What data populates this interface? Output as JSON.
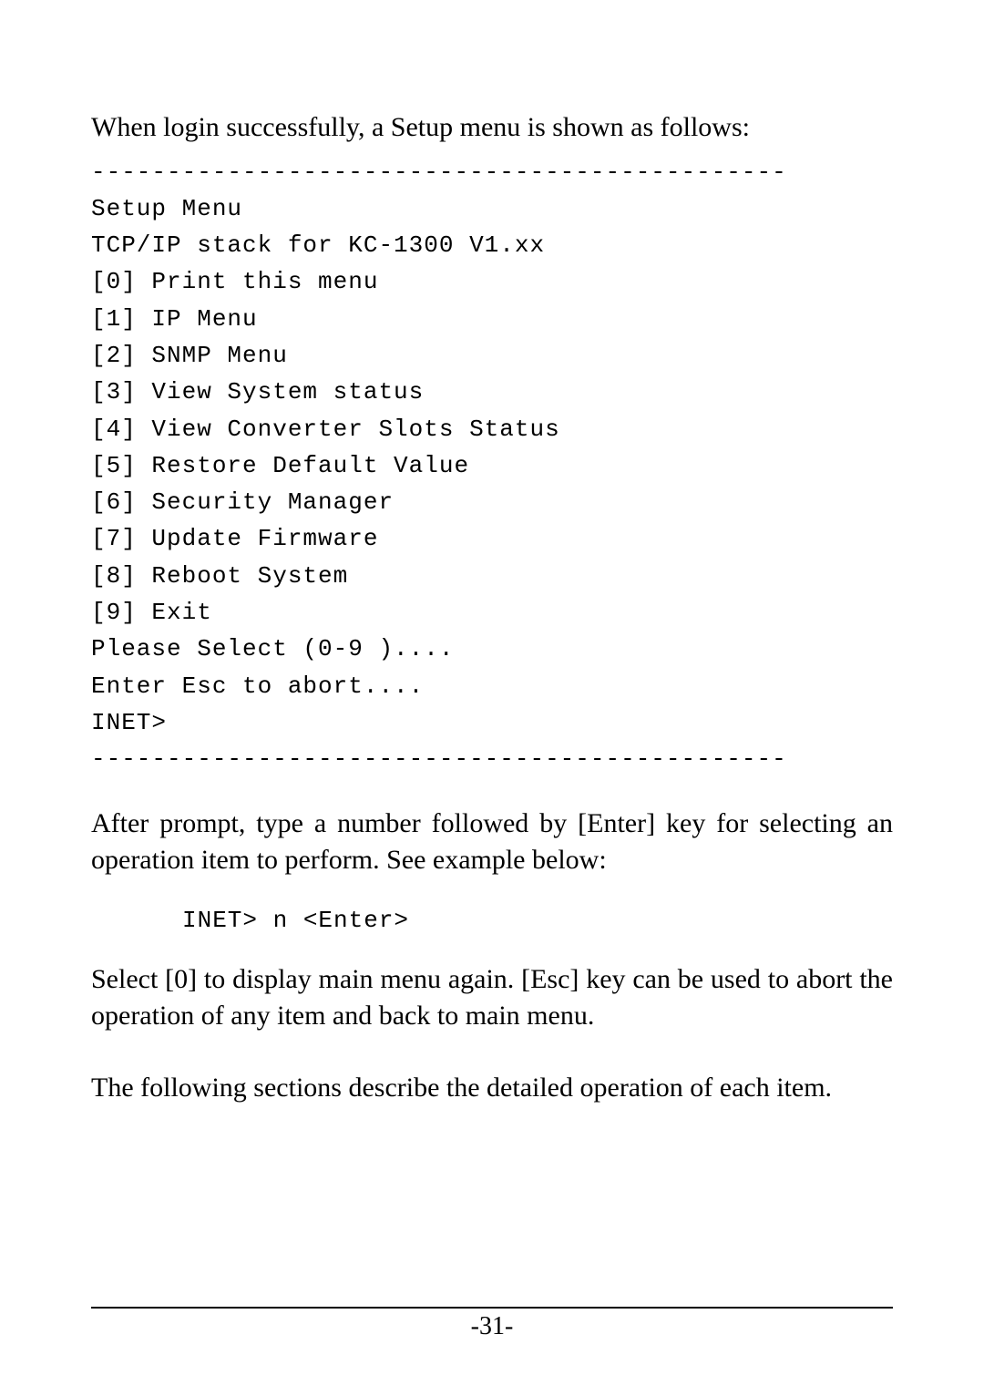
{
  "intro": "When login successfully, a Setup menu is shown as follows:",
  "menu": {
    "rule": "----------------------------------------------",
    "title": "Setup Menu",
    "subtitle": "TCP/IP stack for KC-1300 V1.xx",
    "items": [
      "[0] Print this menu",
      "[1] IP Menu",
      "[2] SNMP Menu",
      "[3] View System status",
      "[4] View Converter Slots Status",
      "[5] Restore Default Value",
      "[6] Security Manager",
      "[7] Update Firmware",
      "[8] Reboot System",
      "[9] Exit"
    ],
    "prompt1": "Please Select (0-9 )....",
    "prompt2": "Enter Esc to abort....",
    "prompt3": "INET>",
    "rule2": "----------------------------------------------"
  },
  "para2": "After prompt, type a number followed by [Enter] key for selecting an operation item to perform. See example below:",
  "example": "INET> n <Enter>",
  "para3": "Select [0] to display main menu again. [Esc] key can be used to abort the operation of any item and back to main menu.",
  "para4": "The following sections describe the detailed operation of each item.",
  "page_number": "-31-"
}
